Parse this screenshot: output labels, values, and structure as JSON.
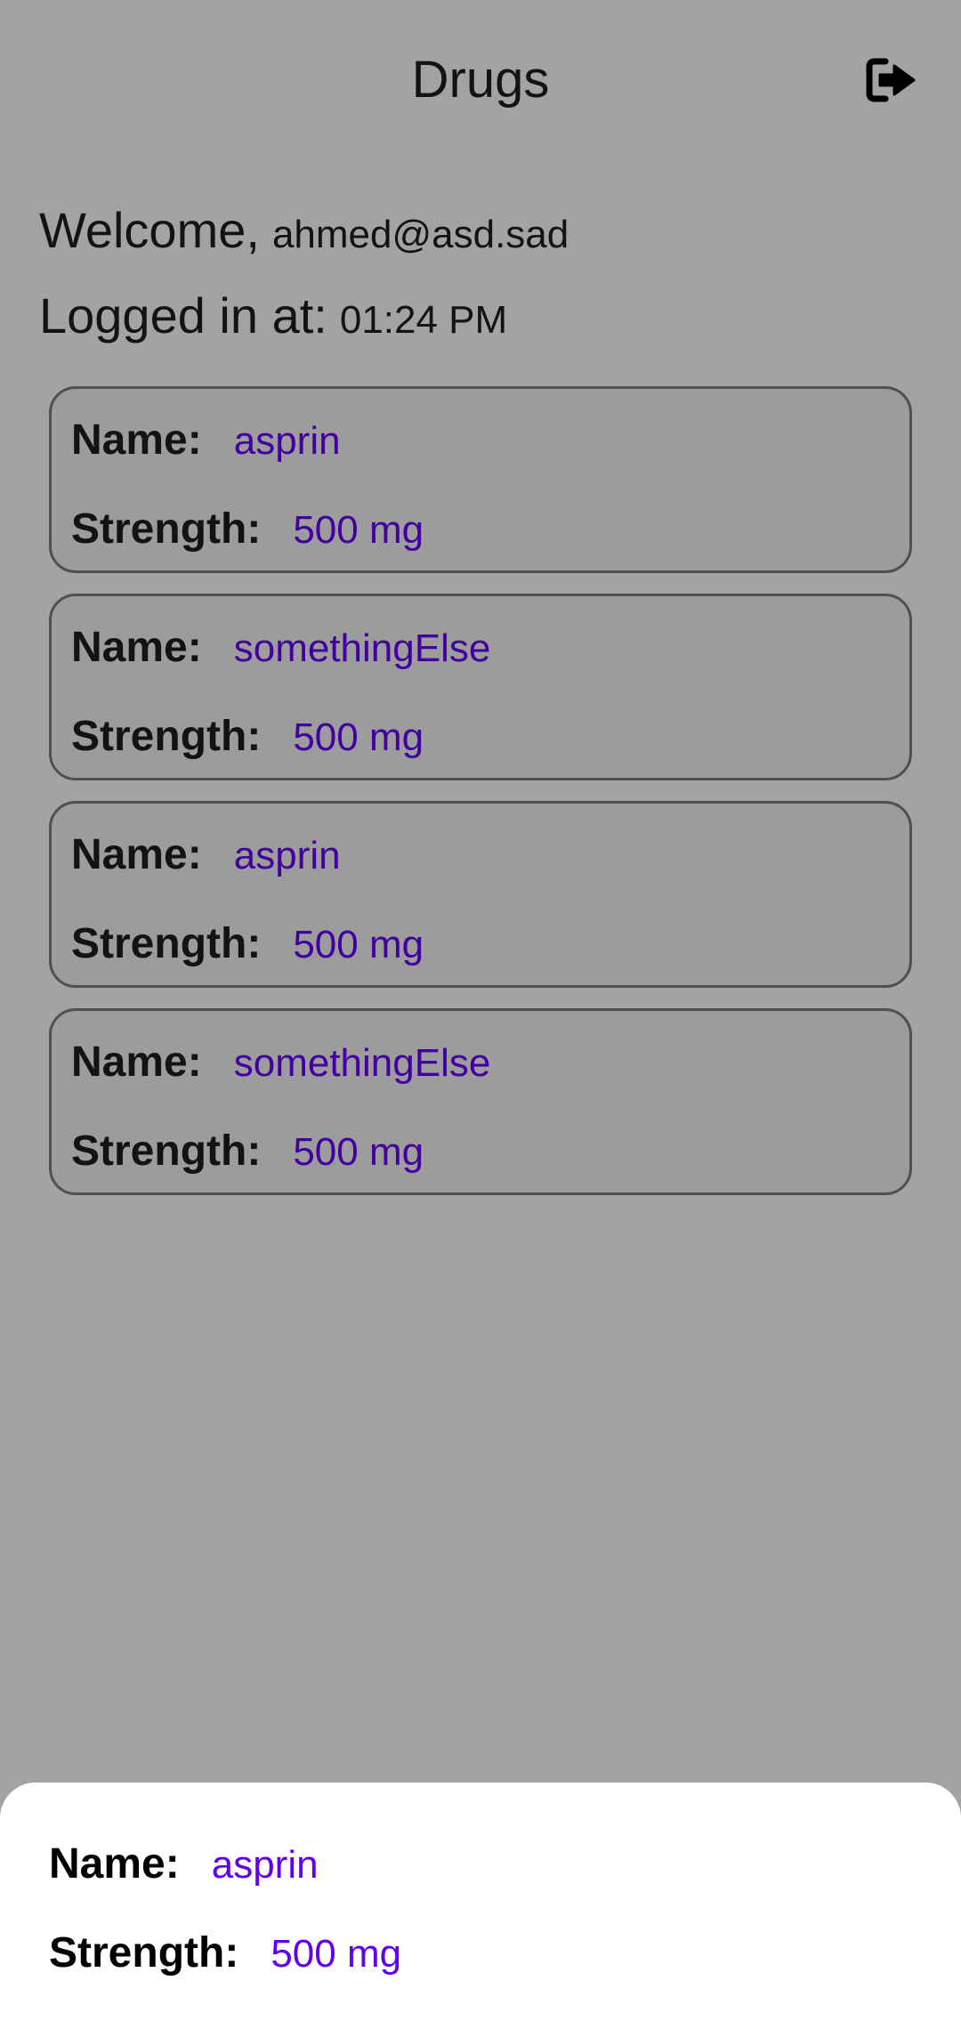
{
  "header": {
    "title": "Drugs",
    "logout_icon": "logout-icon"
  },
  "session": {
    "welcome_label": "Welcome,",
    "email": "ahmed@asd.sad",
    "logged_in_label": "Logged in at:",
    "logged_in_time": "01:24 PM"
  },
  "labels": {
    "name": "Name:",
    "strength": "Strength:"
  },
  "drugs": [
    {
      "name": "asprin",
      "strength": "500 mg"
    },
    {
      "name": "somethingElse",
      "strength": "500 mg"
    },
    {
      "name": "asprin",
      "strength": "500 mg"
    },
    {
      "name": "somethingElse",
      "strength": "500 mg"
    }
  ],
  "bottom_sheet": {
    "name": "asprin",
    "strength": "500 mg"
  },
  "colors": {
    "value_accent": "#6200ee",
    "scrim": "rgba(0,0,0,0.32)"
  }
}
